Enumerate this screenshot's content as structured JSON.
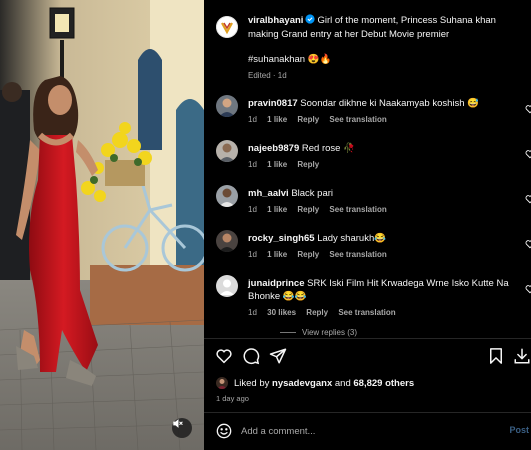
{
  "post": {
    "author": "viralbhayani",
    "caption": "Girl of the moment, Princess Suhana khan making Grand entry at her Debut Movie premier",
    "hashtags": "#suhanakhan 😍🔥",
    "edited_label": "Edited · 1d"
  },
  "comments": [
    {
      "username": "pravin0817",
      "text": "Soondar dikhne ki Naakamyab koshish 😅",
      "age": "1d",
      "likes": "1 like",
      "reply": "Reply",
      "translate": "See translation"
    },
    {
      "username": "najeeb9879",
      "text": "Red rose 🥀",
      "age": "1d",
      "likes": "1 like",
      "reply": "Reply",
      "translate": ""
    },
    {
      "username": "mh_aalvi",
      "text": "Black pari",
      "age": "1d",
      "likes": "1 like",
      "reply": "Reply",
      "translate": "See translation"
    },
    {
      "username": "rocky_singh65",
      "text": "Lady sharukh😂",
      "age": "1d",
      "likes": "1 like",
      "reply": "Reply",
      "translate": "See translation"
    },
    {
      "username": "junaidprince",
      "text": "SRK Iski Film Hit Krwadega Wrne Isko Kutte Na Bhonke 😂😂",
      "age": "1d",
      "likes": "30 likes",
      "reply": "Reply",
      "translate": "See translation"
    }
  ],
  "view_replies": "View replies (3)",
  "engagement": {
    "liked_by_prefix": "Liked by",
    "liked_by_user": "nysadevganx",
    "liked_by_and": "and",
    "others": "68,829 others",
    "time_ago": "1 day ago"
  },
  "composer": {
    "placeholder": "Add a comment...",
    "post_label": "Post"
  },
  "icons": {
    "like": "heart-icon",
    "comment": "comment-icon",
    "share": "send-icon",
    "save": "bookmark-icon",
    "download": "download-icon",
    "emoji": "emoji-icon",
    "mute": "muted-speaker-icon",
    "verified": "verified-badge-icon"
  },
  "colors": {
    "background": "#000000",
    "text": "#f5f5f5",
    "secondary_text": "#a8a8a8",
    "verified": "#0095f6",
    "post_disabled": "#3a5f84",
    "dress_red": "#c2141d"
  }
}
